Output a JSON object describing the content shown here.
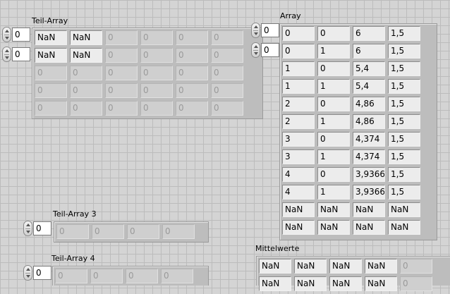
{
  "teil_array": {
    "label": "Teil-Array",
    "indices": [
      "0",
      "0"
    ],
    "rows": [
      [
        "NaN",
        "NaN",
        "0",
        "0",
        "0",
        "0"
      ],
      [
        "NaN",
        "NaN",
        "0",
        "0",
        "0",
        "0"
      ],
      [
        "0",
        "0",
        "0",
        "0",
        "0",
        "0"
      ],
      [
        "0",
        "0",
        "0",
        "0",
        "0",
        "0"
      ],
      [
        "0",
        "0",
        "0",
        "0",
        "0",
        "0"
      ]
    ],
    "active": [
      [
        1,
        1,
        0,
        0,
        0,
        0
      ],
      [
        1,
        1,
        0,
        0,
        0,
        0
      ],
      [
        0,
        0,
        0,
        0,
        0,
        0
      ],
      [
        0,
        0,
        0,
        0,
        0,
        0
      ],
      [
        0,
        0,
        0,
        0,
        0,
        0
      ]
    ]
  },
  "array": {
    "label": "Array",
    "indices": [
      "0",
      "0"
    ],
    "rows": [
      [
        "0",
        "0",
        "6",
        "1,5"
      ],
      [
        "0",
        "1",
        "6",
        "1,5"
      ],
      [
        "1",
        "0",
        "5,4",
        "1,5"
      ],
      [
        "1",
        "1",
        "5,4",
        "1,5"
      ],
      [
        "2",
        "0",
        "4,86",
        "1,5"
      ],
      [
        "2",
        "1",
        "4,86",
        "1,5"
      ],
      [
        "3",
        "0",
        "4,374",
        "1,5"
      ],
      [
        "3",
        "1",
        "4,374",
        "1,5"
      ],
      [
        "4",
        "0",
        "3,9366",
        "1,5"
      ],
      [
        "4",
        "1",
        "3,9366",
        "1,5"
      ],
      [
        "NaN",
        "NaN",
        "NaN",
        "NaN"
      ],
      [
        "NaN",
        "NaN",
        "NaN",
        "NaN"
      ]
    ]
  },
  "teil_array_3": {
    "label": "Teil-Array 3",
    "indices": [
      "0"
    ],
    "rows": [
      [
        "0",
        "0",
        "0",
        "0"
      ]
    ],
    "active": [
      [
        0,
        0,
        0,
        0
      ]
    ]
  },
  "teil_array_4": {
    "label": "Teil-Array 4",
    "indices": [
      "0"
    ],
    "rows": [
      [
        "0",
        "0",
        "0",
        "0"
      ]
    ],
    "active": [
      [
        0,
        0,
        0,
        0
      ]
    ]
  },
  "mittelwerte": {
    "label": "Mittelwerte",
    "rows": [
      [
        "NaN",
        "NaN",
        "NaN",
        "NaN",
        "0"
      ],
      [
        "NaN",
        "NaN",
        "NaN",
        "NaN",
        "0"
      ]
    ],
    "active": [
      [
        1,
        1,
        1,
        1,
        0
      ],
      [
        1,
        1,
        1,
        1,
        0
      ]
    ]
  }
}
